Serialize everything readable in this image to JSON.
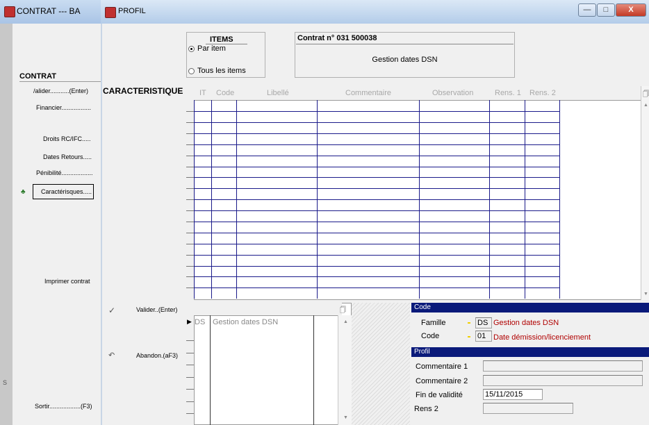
{
  "back_window": {
    "title": "CONTRAT  ---  BA",
    "heading": "CONTRAT",
    "links": {
      "valider": "/alider...........(Enter)",
      "financier": "Financier.................",
      "droits": "Droits RC/IFC.....",
      "dates_retours": "Dates Retours.....",
      "penibilite": "Pénibilité..................",
      "caracteristiques": "Caractérisques.....",
      "imprimer": "Imprimer contrat",
      "sortir": "Sortir..................(F3)"
    },
    "edge_char": "S"
  },
  "window": {
    "title": "PROFIL",
    "buttons": {
      "minimize": "—",
      "maximize": "□",
      "close": "X"
    }
  },
  "items": {
    "label": "ITEMS",
    "option1": "Par item",
    "option2": "Tous les items",
    "selected": "Par item"
  },
  "contrat": {
    "label": "Contrat n° 031 500038",
    "value": "Gestion dates DSN"
  },
  "caracteristique": {
    "label": "CARACTERISTIQUE",
    "columns": [
      "IT",
      "Code",
      "Libellé",
      "Commentaire",
      "Observation",
      "Rens. 1",
      "Rens. 2"
    ]
  },
  "actions": {
    "valider": "Valider..(Enter)",
    "abandon": "Abandon.(aF3)"
  },
  "small_grid": {
    "row": {
      "code": "DS",
      "label": "Gestion dates DSN"
    }
  },
  "code_section": {
    "band": "Code",
    "famille_label": "Famille",
    "famille_value": "DS",
    "famille_desc": "Gestion dates DSN",
    "code_label": "Code",
    "code_value": "01",
    "code_desc": "Date démission/licenciement"
  },
  "profil_section": {
    "band": "Profil",
    "commentaire1_label": "Commentaire 1",
    "commentaire1_value": "",
    "commentaire2_label": "Commentaire 2",
    "commentaire2_value": "",
    "fin_validite_label": "Fin de validité",
    "fin_validite_value": "15/11/2015",
    "rens2_label": "Rens 2",
    "rens2_value": ""
  }
}
